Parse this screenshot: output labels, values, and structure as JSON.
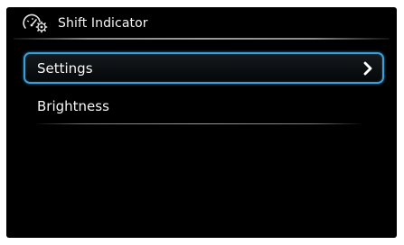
{
  "header": {
    "title": "Shift Indicator",
    "icon": "gauge-gear-icon"
  },
  "menu": {
    "items": [
      {
        "label": "Settings",
        "selected": true,
        "icon": "chevron-right-icon"
      },
      {
        "label": "Brightness",
        "selected": false
      }
    ]
  },
  "colors": {
    "background": "#000000",
    "text": "#f5f5f5",
    "selection_border": "#3a9fd6",
    "divider": "#9a9a9a"
  }
}
